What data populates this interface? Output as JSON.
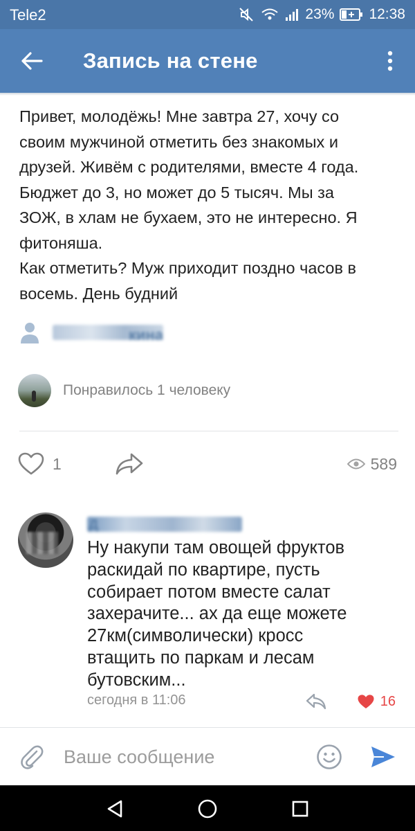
{
  "status_bar": {
    "carrier": "Tele2",
    "battery_percent": "23%",
    "time": "12:38"
  },
  "app_bar": {
    "title": "Запись на стене",
    "back_icon": "arrow-left-icon",
    "menu_icon": "more-vertical-icon"
  },
  "post": {
    "lines": [
      "Привет, молодёжь! Мне завтра 27, хочу со",
      "своим мужчиной отметить без знакомых и",
      "друзей. Живём с родителями, вместе 4 года.",
      "Бюджет до 3, но может до 5 тысяч. Мы за",
      "ЗОЖ, в хлам не бухаем, это не интересно. Я",
      "фитоняша.",
      "Как отметить? Муж приходит поздно часов в",
      "восемь. День будний"
    ],
    "author_visible_fragment": "кина",
    "liked_by_text": "Понравилось 1 человеку",
    "like_count": "1",
    "views_count": "589"
  },
  "comment": {
    "author_visible_fragment": "Д",
    "lines": [
      "Ну накупи там овощей фруктов",
      "раскидай по квартире, пусть",
      "собирает потом вместе салат",
      "захерачите... ах да еще можете",
      "27км(символически) кросс",
      "втащить по паркам и лесам",
      "бутовским..."
    ],
    "timestamp": "сегодня в 11:06",
    "like_count": "16"
  },
  "composer": {
    "placeholder": "Ваше сообщение"
  },
  "colors": {
    "status_bar": "#4a76a8",
    "app_bar": "#5181b8",
    "text": "#222222",
    "secondary_text": "#828282",
    "like_red": "#e64646",
    "send_blue": "#4a86d8"
  }
}
